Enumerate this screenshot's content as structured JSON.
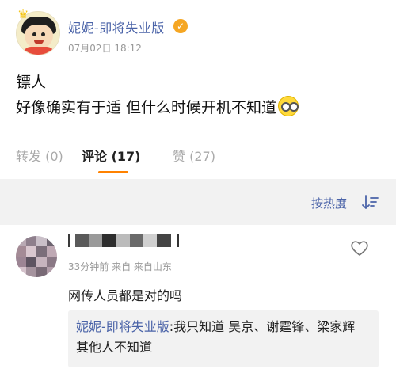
{
  "post": {
    "username": "妮妮-即将失业版",
    "timestamp": "07月02日 18:12",
    "lines": [
      "镖人",
      "好像确实有于适 但什么时候开机不知道"
    ],
    "emoji_icon": "nerd-face-icon"
  },
  "tabs": [
    {
      "label": "转发 (0)",
      "active": false
    },
    {
      "label": "评论 (17)",
      "active": true
    },
    {
      "label": "赞 (27)",
      "active": false
    }
  ],
  "sort": {
    "label": "按热度",
    "icon": "sort-descending-icon"
  },
  "comment": {
    "meta": "33分钟前 来自 来自山东",
    "text": "网传人员都是对的吗",
    "reply": {
      "author": "妮妮-即将失业版",
      "text": ":我只知道 吴京、谢霆锋、梁家辉 其他人不知道"
    },
    "like_icon": "heart-outline-icon"
  },
  "colors": {
    "link": "#4a63a8",
    "accent": "#ff8200",
    "verified": "#f5a623",
    "muted": "#999999",
    "panel": "#f2f2f2"
  }
}
